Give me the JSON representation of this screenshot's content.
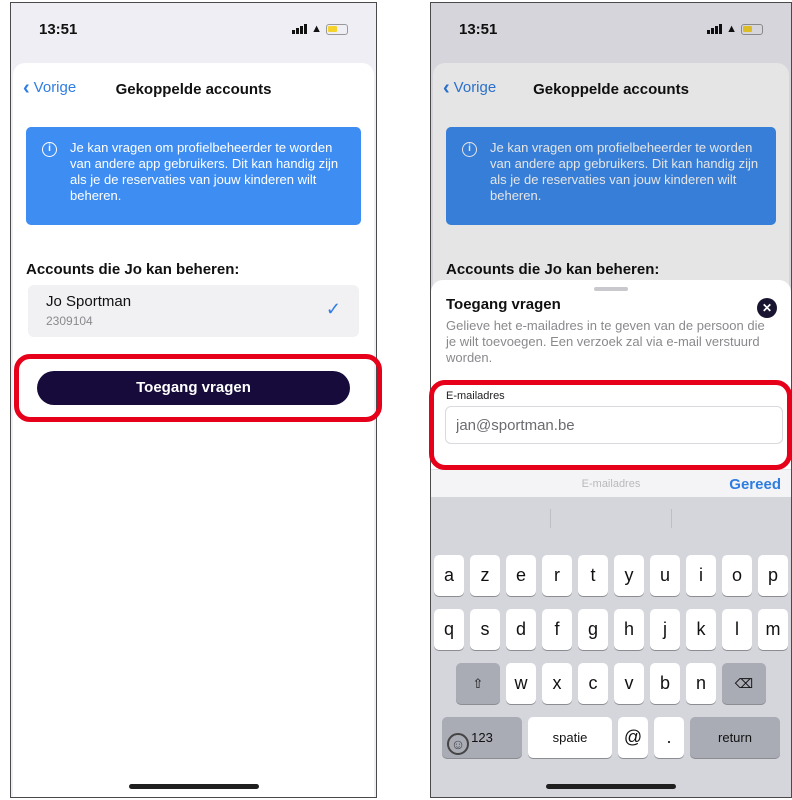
{
  "left": {
    "status": {
      "time": "13:51"
    },
    "nav": {
      "back_label": "Vorige",
      "title": "Gekoppelde accounts"
    },
    "info_text": "Je kan vragen om profielbeheerder te worden van andere app gebruikers. Dit kan handig zijn als je de reservaties van jouw kinderen wilt beheren.",
    "section_title": "Accounts die Jo kan beheren:",
    "account": {
      "name": "Jo Sportman",
      "number": "2309104"
    },
    "primary_button": "Toegang vragen"
  },
  "right": {
    "status": {
      "time": "13:51"
    },
    "nav": {
      "back_label": "Vorige",
      "title": "Gekoppelde accounts"
    },
    "info_text": "Je kan vragen om profielbeheerder te worden van andere app gebruikers. Dit kan handig zijn als je de reservaties van jouw kinderen wilt beheren.",
    "section_title": "Accounts die Jo kan beheren:",
    "modal": {
      "title": "Toegang vragen",
      "description": "Gelieve het e-mailadres in te geven van de persoon die je wilt toevoegen. Een verzoek zal via e-mail verstuurd worden.",
      "field_label": "E-mailadres",
      "field_value": "jan@sportman.be"
    },
    "accessory": {
      "placeholder": "E-mailadres",
      "done": "Gereed"
    },
    "keyboard": {
      "row1": [
        "a",
        "z",
        "e",
        "r",
        "t",
        "y",
        "u",
        "i",
        "o",
        "p"
      ],
      "row2": [
        "q",
        "s",
        "d",
        "f",
        "g",
        "h",
        "j",
        "k",
        "l",
        "m"
      ],
      "row3": [
        "w",
        "x",
        "c",
        "v",
        "b",
        "n"
      ],
      "numbers_key": "123",
      "space_key": "spatie",
      "at_key": "@",
      "dot_key": ".",
      "return_key": "return"
    }
  },
  "colors": {
    "accent": "#2f7de1",
    "info": "#3e8df2",
    "button": "#160b3a",
    "highlight": "#e6001a"
  }
}
